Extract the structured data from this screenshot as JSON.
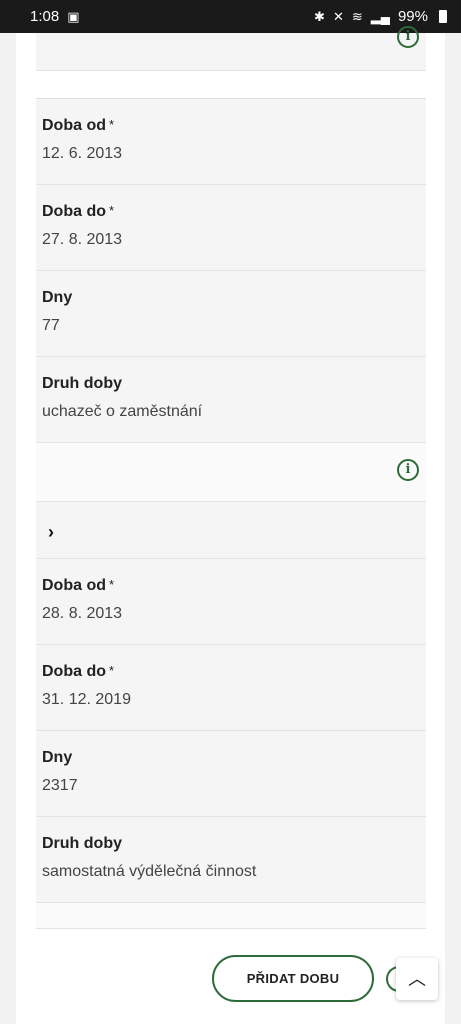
{
  "status_bar": {
    "time": "1:08",
    "battery": "99%"
  },
  "records": [
    {
      "doba_od_label": "Doba od",
      "doba_od_value": "12. 6. 2013",
      "doba_do_label": "Doba do",
      "doba_do_value": "27. 8. 2013",
      "dny_label": "Dny",
      "dny_value": "77",
      "druh_label": "Druh doby",
      "druh_value": "uchazeč o zaměstnání"
    },
    {
      "doba_od_label": "Doba od",
      "doba_od_value": "28. 8. 2013",
      "doba_do_label": "Doba do",
      "doba_do_value": "31. 12. 2019",
      "dny_label": "Dny",
      "dny_value": "2317",
      "druh_label": "Druh doby",
      "druh_value": "samostatná výdělečná činnost"
    }
  ],
  "required_marker": "*",
  "add_button_label": "PŘIDAT DOBU",
  "icons": {
    "info": "info-icon",
    "expand": "chevron-right-icon",
    "scroll_top": "chevron-up-icon"
  },
  "colors": {
    "accent": "#2e6b3a"
  }
}
